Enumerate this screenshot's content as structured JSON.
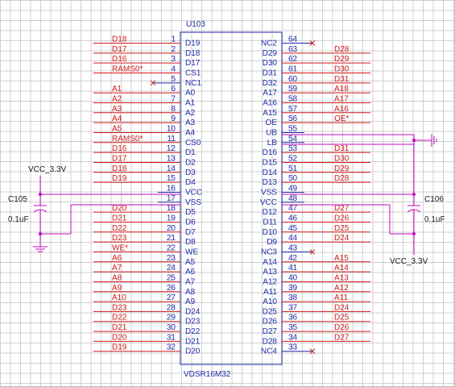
{
  "colors": {
    "pin": "#1f2aa8",
    "net": "#d01a1a",
    "junction": "#c40bbf",
    "grid": "#cfcfcf"
  },
  "chip": {
    "ref": "U103",
    "part": "VDSR16M32",
    "left_pins": [
      {
        "num": "1",
        "name": "D19",
        "net": "D18"
      },
      {
        "num": "2",
        "name": "D18",
        "net": "D17"
      },
      {
        "num": "3",
        "name": "D17",
        "net": "D16"
      },
      {
        "num": "4",
        "name": "CS1",
        "net": "RAMS0*"
      },
      {
        "num": "5",
        "name": "NC1",
        "net": ""
      },
      {
        "num": "6",
        "name": "A0",
        "net": "A1"
      },
      {
        "num": "7",
        "name": "A1",
        "net": "A2"
      },
      {
        "num": "8",
        "name": "A2",
        "net": "A3"
      },
      {
        "num": "9",
        "name": "A3",
        "net": "A4"
      },
      {
        "num": "10",
        "name": "A4",
        "net": "A5"
      },
      {
        "num": "11",
        "name": "CS0",
        "net": "RAMS0*"
      },
      {
        "num": "12",
        "name": "D1",
        "net": "D16"
      },
      {
        "num": "13",
        "name": "D2",
        "net": "D17"
      },
      {
        "num": "14",
        "name": "D3",
        "net": "D18"
      },
      {
        "num": "15",
        "name": "D4",
        "net": "D19"
      },
      {
        "num": "16",
        "name": "VCC",
        "net": ""
      },
      {
        "num": "17",
        "name": "VSS",
        "net": ""
      },
      {
        "num": "18",
        "name": "D5",
        "net": "D20"
      },
      {
        "num": "19",
        "name": "D6",
        "net": "D21"
      },
      {
        "num": "20",
        "name": "D7",
        "net": "D22"
      },
      {
        "num": "21",
        "name": "D8",
        "net": "D23"
      },
      {
        "num": "22",
        "name": "WE",
        "net": "WE*"
      },
      {
        "num": "23",
        "name": "A5",
        "net": "A6"
      },
      {
        "num": "24",
        "name": "A6",
        "net": "A7"
      },
      {
        "num": "25",
        "name": "A7",
        "net": "A8"
      },
      {
        "num": "26",
        "name": "A8",
        "net": "A9"
      },
      {
        "num": "27",
        "name": "A9",
        "net": "A10"
      },
      {
        "num": "28",
        "name": "D24",
        "net": "D23"
      },
      {
        "num": "29",
        "name": "D23",
        "net": "D22"
      },
      {
        "num": "30",
        "name": "D22",
        "net": "D21"
      },
      {
        "num": "31",
        "name": "D21",
        "net": "D20"
      },
      {
        "num": "32",
        "name": "D20",
        "net": "D19"
      }
    ],
    "right_pins": [
      {
        "num": "64",
        "name": "NC2",
        "net": ""
      },
      {
        "num": "63",
        "name": "D29",
        "net": "D28"
      },
      {
        "num": "62",
        "name": "D30",
        "net": "D29"
      },
      {
        "num": "61",
        "name": "D31",
        "net": "D30"
      },
      {
        "num": "60",
        "name": "D32",
        "net": "D31"
      },
      {
        "num": "59",
        "name": "A17",
        "net": "A18"
      },
      {
        "num": "58",
        "name": "A16",
        "net": "A17"
      },
      {
        "num": "57",
        "name": "A15",
        "net": "A16"
      },
      {
        "num": "56",
        "name": "OE",
        "net": "OE*"
      },
      {
        "num": "55",
        "name": "UB",
        "net": ""
      },
      {
        "num": "54",
        "name": "LB",
        "net": ""
      },
      {
        "num": "53",
        "name": "D16",
        "net": "D31"
      },
      {
        "num": "52",
        "name": "D15",
        "net": "D30"
      },
      {
        "num": "51",
        "name": "D14",
        "net": "D29"
      },
      {
        "num": "50",
        "name": "D13",
        "net": "D28"
      },
      {
        "num": "49",
        "name": "VSS",
        "net": ""
      },
      {
        "num": "48",
        "name": "VCC",
        "net": ""
      },
      {
        "num": "47",
        "name": "D12",
        "net": "D27"
      },
      {
        "num": "46",
        "name": "D11",
        "net": "D26"
      },
      {
        "num": "45",
        "name": "D10",
        "net": "D25"
      },
      {
        "num": "44",
        "name": "D9",
        "net": "D24"
      },
      {
        "num": "43",
        "name": "NC3",
        "net": ""
      },
      {
        "num": "42",
        "name": "A14",
        "net": "A15"
      },
      {
        "num": "41",
        "name": "A13",
        "net": "A14"
      },
      {
        "num": "40",
        "name": "A12",
        "net": "A13"
      },
      {
        "num": "39",
        "name": "A11",
        "net": "A12"
      },
      {
        "num": "38",
        "name": "A10",
        "net": "A11"
      },
      {
        "num": "37",
        "name": "D25",
        "net": "D24"
      },
      {
        "num": "36",
        "name": "D26",
        "net": "D25"
      },
      {
        "num": "35",
        "name": "D27",
        "net": "D26"
      },
      {
        "num": "34",
        "name": "D28",
        "net": "D27"
      },
      {
        "num": "33",
        "name": "NC4",
        "net": ""
      }
    ]
  },
  "left_cap": {
    "ref": "C105",
    "value": "0.1uF",
    "supply": "VCC_3.3V"
  },
  "right_cap": {
    "ref": "C106",
    "value": "0.1uF",
    "supply": "VCC_3.3V"
  }
}
